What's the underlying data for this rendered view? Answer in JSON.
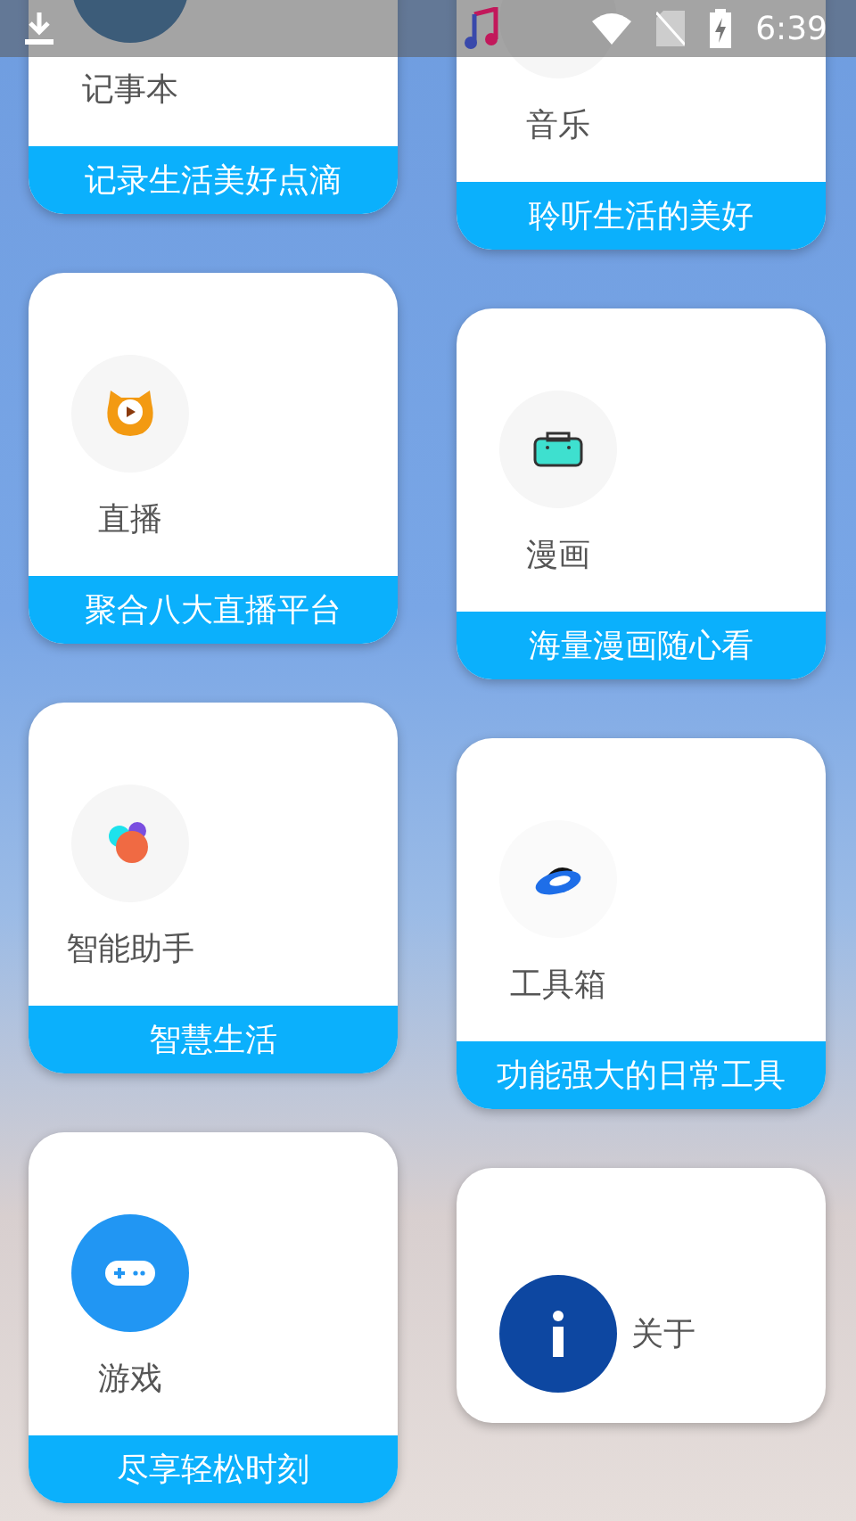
{
  "status_bar": {
    "time": "6:39"
  },
  "columns": [
    {
      "cards": [
        {
          "kind": "app",
          "title": "记事本",
          "subtitle": "记录生活美好点滴"
        },
        {
          "kind": "app",
          "title": "直播",
          "subtitle": "聚合八大直播平台"
        },
        {
          "kind": "app",
          "title": "智能助手",
          "subtitle": "智慧生活"
        },
        {
          "kind": "app",
          "title": "游戏",
          "subtitle": "尽享轻松时刻"
        }
      ]
    },
    {
      "cards": [
        {
          "kind": "app",
          "title": "音乐",
          "subtitle": "聆听生活的美好"
        },
        {
          "kind": "app",
          "title": "漫画",
          "subtitle": "海量漫画随心看"
        },
        {
          "kind": "app",
          "title": "工具箱",
          "subtitle": "功能强大的日常工具"
        },
        {
          "kind": "about",
          "title": "关于"
        }
      ]
    }
  ]
}
